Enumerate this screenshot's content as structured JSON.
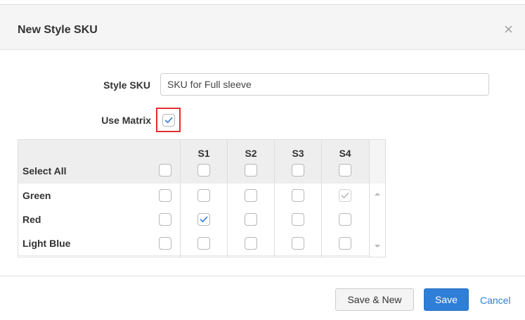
{
  "dialog": {
    "title": "New Style SKU",
    "close_glyph": "×"
  },
  "form": {
    "style_sku_label": "Style SKU",
    "style_sku_value": "SKU for Full sleeve",
    "use_matrix_label": "Use Matrix",
    "use_matrix_checked": true
  },
  "matrix": {
    "select_all_label": "Select All",
    "columns": [
      "S1",
      "S2",
      "S3",
      "S4"
    ],
    "rows": [
      {
        "label": "Green",
        "row_checked": false,
        "cells": [
          false,
          false,
          false,
          true
        ],
        "disabled_checked": [
          false,
          false,
          false,
          true
        ]
      },
      {
        "label": "Red",
        "row_checked": false,
        "cells": [
          true,
          false,
          false,
          false
        ],
        "disabled_checked": [
          false,
          false,
          false,
          false
        ]
      },
      {
        "label": "Light Blue",
        "row_checked": false,
        "cells": [
          false,
          false,
          false,
          false
        ],
        "disabled_checked": [
          false,
          false,
          false,
          false
        ]
      }
    ]
  },
  "footer": {
    "save_new_label": "Save & New",
    "save_label": "Save",
    "cancel_label": "Cancel"
  },
  "colors": {
    "accent": "#2f7ed8",
    "highlight_border": "#e03030",
    "check_color": "#2f7ed8",
    "disabled_check_color": "#b9b9b9"
  }
}
